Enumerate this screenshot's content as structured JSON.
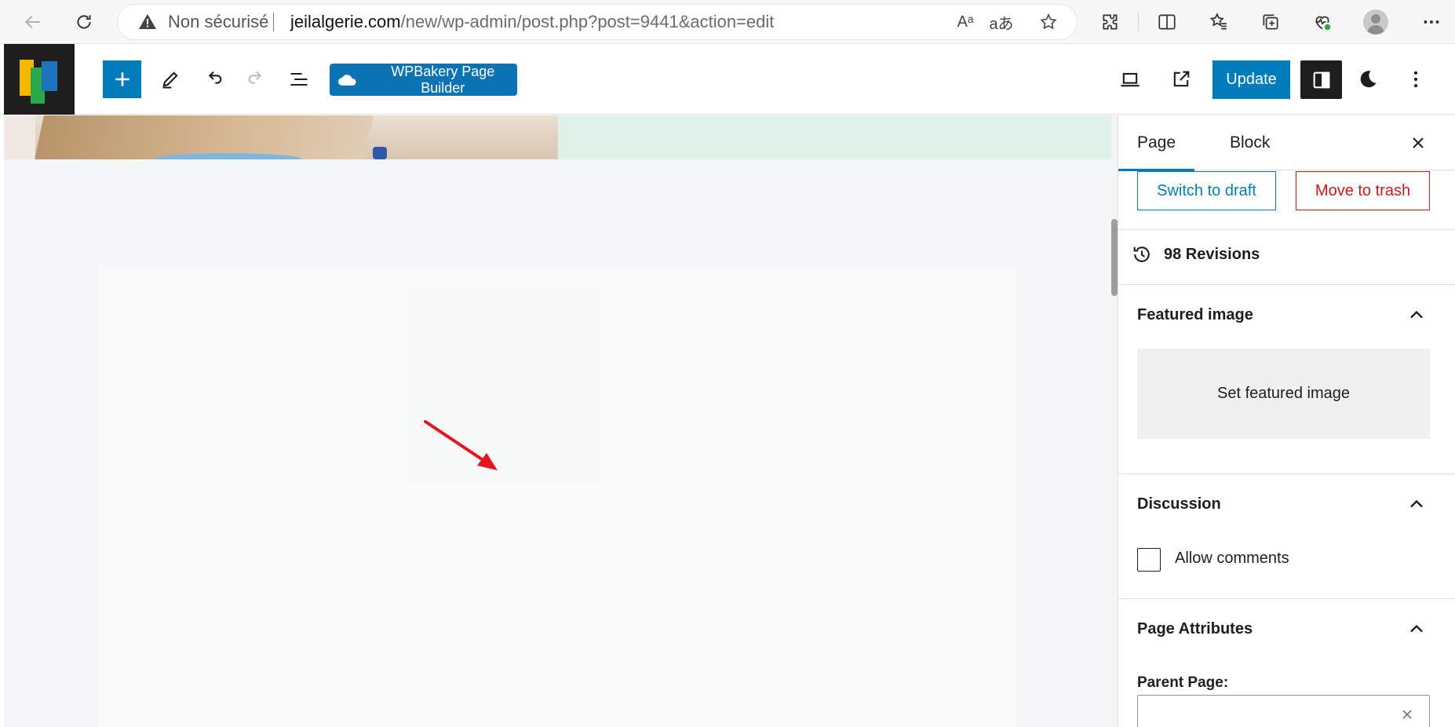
{
  "browser": {
    "security_label": "Non sécurisé",
    "url_host": "jeilalgerie.com",
    "url_path": "/new/wp-admin/post.php?post=9441&action=edit",
    "read_aloud_glyph": "Aᵃ",
    "translate_glyph": "aあ"
  },
  "toolbar": {
    "wpbakery_label": "WPBakery Page Builder",
    "update_label": "Update"
  },
  "sidebar": {
    "tabs": [
      {
        "label": "Page",
        "active": true
      },
      {
        "label": "Block",
        "active": false
      }
    ],
    "switch_to_draft_label": "Switch to draft",
    "move_to_trash_label": "Move to trash",
    "revisions_label": "98 Revisions",
    "featured_image": {
      "title": "Featured image",
      "set_label": "Set featured image"
    },
    "discussion": {
      "title": "Discussion",
      "allow_comments_label": "Allow comments",
      "allow_comments_checked": false
    },
    "page_attributes": {
      "title": "Page Attributes",
      "parent_page_label": "Parent Page:",
      "parent_page_value": ""
    }
  },
  "colors": {
    "wp_blue": "#007cba",
    "danger_red": "#cc1818",
    "annotation_arrow": "#e8141b",
    "canvas_bg": "#f4f7f7"
  }
}
